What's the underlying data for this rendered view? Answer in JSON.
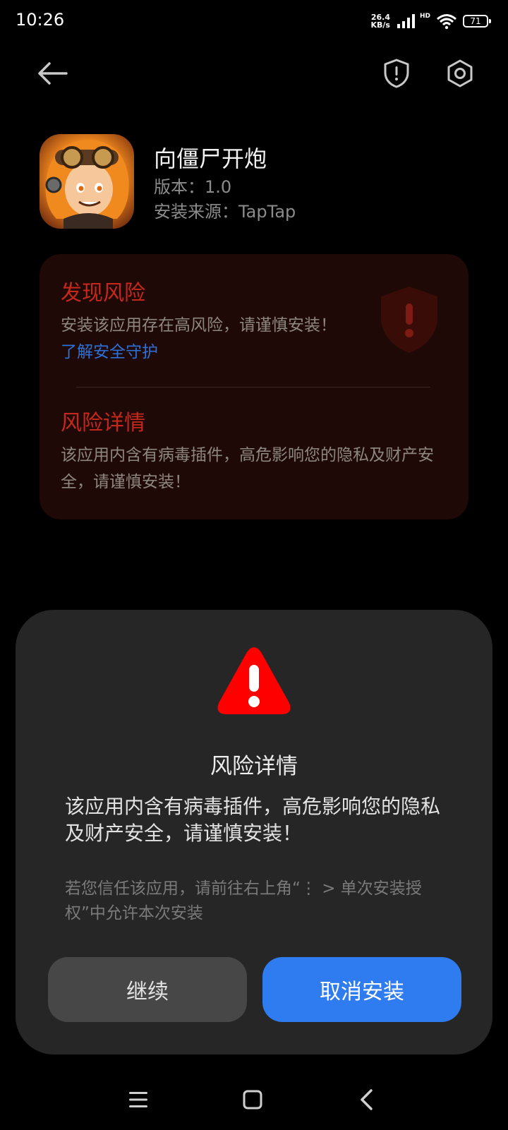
{
  "status_bar": {
    "time": "10:26",
    "net_speed_value": "26.4",
    "net_speed_unit": "KB/s",
    "hd_label": "HD",
    "battery": "71"
  },
  "icons": {
    "back": "back-arrow-icon",
    "security": "shield-icon",
    "settings": "gear-icon"
  },
  "app": {
    "name": "向僵尸开炮",
    "version": "版本：1.0",
    "source": "安装来源：TapTap"
  },
  "risk_card": {
    "title": "发现风险",
    "message": "安装该应用存在高风险，请谨慎安装！",
    "link": "了解安全守护",
    "details_title": "风险详情",
    "details_text": "该应用内含有病毒插件，高危影响您的隐私及财产安全，请谨慎安装！"
  },
  "dialog": {
    "title": "风险详情",
    "body": "该应用内含有病毒插件，高危影响您的隐私及财产安全，请谨慎安装！",
    "note": "若您信任该应用，请前往右上角“⋮ > 单次安装授权”中允许本次安装",
    "continue_label": "继续",
    "cancel_label": "取消安装"
  },
  "colors": {
    "danger": "#c4281c",
    "link": "#2d70d8",
    "primary_button": "#2f7cf0",
    "warning_triangle": "#ff0000"
  }
}
